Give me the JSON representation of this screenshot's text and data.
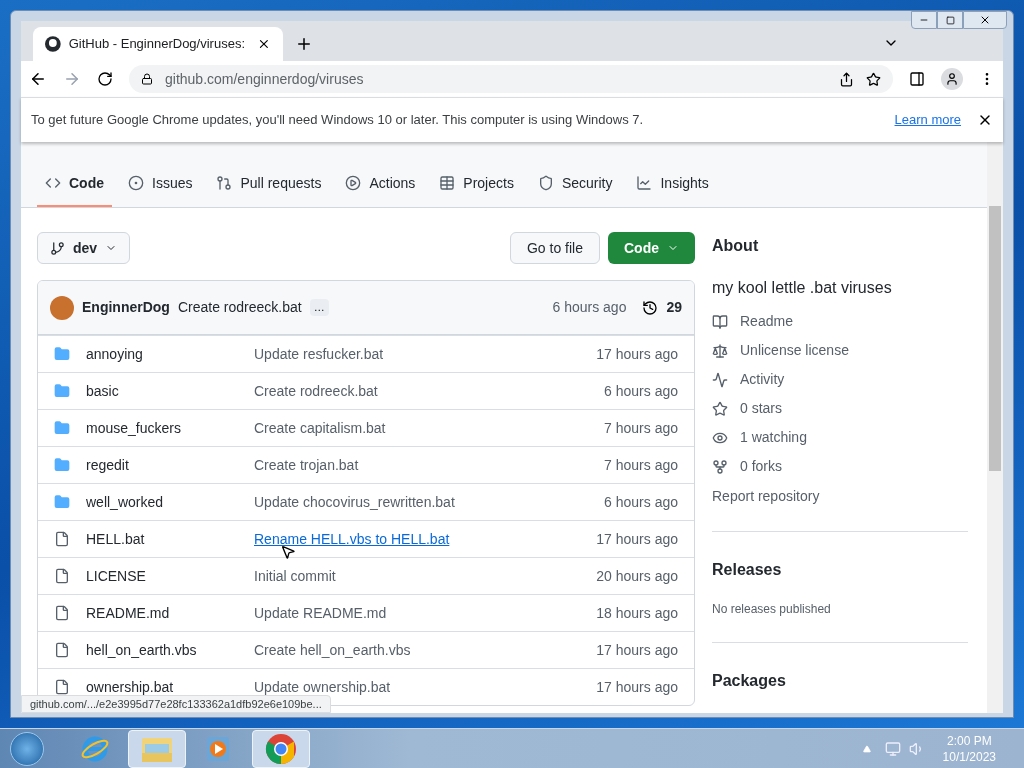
{
  "browser": {
    "tab_title": "GitHub - EnginnerDog/viruses:",
    "address": "github.com/enginnerdog/viruses",
    "infobar": {
      "message": "To get future Google Chrome updates, you'll need Windows 10 or later. This computer is using Windows 7.",
      "link": "Learn more"
    }
  },
  "repo_nav": [
    {
      "kind": "code",
      "label": "Code",
      "selected": true
    },
    {
      "kind": "issues",
      "label": "Issues",
      "selected": false
    },
    {
      "kind": "pulls",
      "label": "Pull requests",
      "selected": false
    },
    {
      "kind": "actions",
      "label": "Actions",
      "selected": false
    },
    {
      "kind": "projects",
      "label": "Projects",
      "selected": false
    },
    {
      "kind": "security",
      "label": "Security",
      "selected": false
    },
    {
      "kind": "insights",
      "label": "Insights",
      "selected": false
    }
  ],
  "branch": "dev",
  "go_to_file": "Go to file",
  "code_button": "Code",
  "latest_commit": {
    "author": "EnginnerDog",
    "message": "Create rodreeck.bat",
    "more": "…",
    "time": "6 hours ago",
    "commits": "29"
  },
  "files": [
    {
      "kind": "folder",
      "name": "annoying",
      "commit": "Update resfucker.bat",
      "time": "17 hours ago",
      "hovered": false
    },
    {
      "kind": "folder",
      "name": "basic",
      "commit": "Create rodreeck.bat",
      "time": "6 hours ago",
      "hovered": false
    },
    {
      "kind": "folder",
      "name": "mouse_fuckers",
      "commit": "Create capitalism.bat",
      "time": "7 hours ago",
      "hovered": false
    },
    {
      "kind": "folder",
      "name": "regedit",
      "commit": "Create trojan.bat",
      "time": "7 hours ago",
      "hovered": false
    },
    {
      "kind": "folder",
      "name": "well_worked",
      "commit": "Update chocovirus_rewritten.bat",
      "time": "6 hours ago",
      "hovered": false
    },
    {
      "kind": "file",
      "name": "HELL.bat",
      "commit": "Rename HELL.vbs to HELL.bat",
      "time": "17 hours ago",
      "hovered": true
    },
    {
      "kind": "file",
      "name": "LICENSE",
      "commit": "Initial commit",
      "time": "20 hours ago",
      "hovered": false
    },
    {
      "kind": "file",
      "name": "README.md",
      "commit": "Update README.md",
      "time": "18 hours ago",
      "hovered": false
    },
    {
      "kind": "file",
      "name": "hell_on_earth.vbs",
      "commit": "Create hell_on_earth.vbs",
      "time": "17 hours ago",
      "hovered": false
    },
    {
      "kind": "file",
      "name": "ownership.bat",
      "commit": "Update ownership.bat",
      "time": "17 hours ago",
      "hovered": false
    }
  ],
  "about": {
    "title": "About",
    "description": "my kool lettle .bat viruses",
    "items": [
      {
        "kind": "readme",
        "label": "Readme"
      },
      {
        "kind": "license",
        "label": "Unlicense license"
      },
      {
        "kind": "activity",
        "label": "Activity"
      },
      {
        "kind": "stars",
        "label": "0 stars"
      },
      {
        "kind": "watching",
        "label": "1 watching"
      },
      {
        "kind": "forks",
        "label": "0 forks"
      }
    ],
    "report": "Report repository"
  },
  "releases": {
    "title": "Releases",
    "note": "No releases published"
  },
  "packages": {
    "title": "Packages"
  },
  "status_bubble": "github.com/.../e2e3995d77e28fc133362a1dfb92e6e109be...",
  "taskbar": [
    {
      "kind": "ie",
      "selected": false
    },
    {
      "kind": "explorer",
      "selected": true
    },
    {
      "kind": "media",
      "selected": false
    },
    {
      "kind": "chrome",
      "selected": true
    }
  ],
  "clock": {
    "time": "2:00 PM",
    "date": "10/1/2023"
  }
}
